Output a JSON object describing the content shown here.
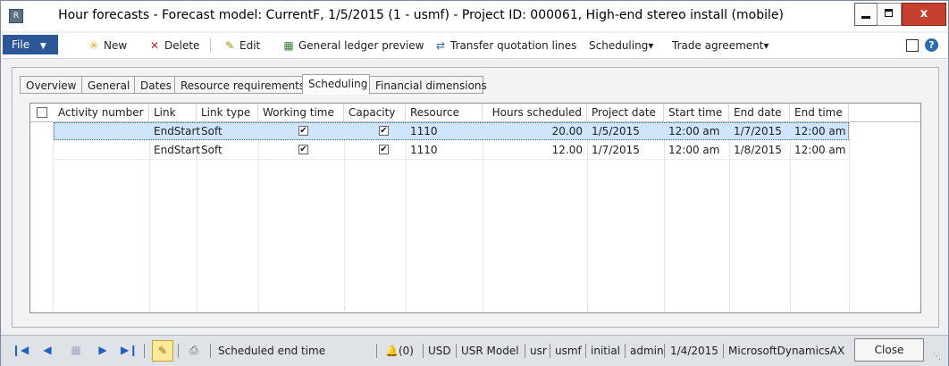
{
  "window": {
    "title": "Hour forecasts - Forecast model: CurrentF, 1/5/2015 (1 - usmf) - Project ID: 000061, High-end stereo install (mobile)",
    "close_glyph": "x",
    "app_icon_glyph": "R"
  },
  "ribbon": {
    "file": "File",
    "new": "New",
    "delete": "Delete",
    "edit": "Edit",
    "gl_preview": "General ledger preview",
    "transfer": "Transfer quotation lines",
    "scheduling": "Scheduling",
    "trade_agreement": "Trade agreement",
    "dropdown_glyph": "▾"
  },
  "tabs": [
    "Overview",
    "General",
    "Dates",
    "Resource requirements",
    "Scheduling",
    "Financial dimensions"
  ],
  "grid": {
    "columns": [
      "Activity number",
      "Link",
      "Link type",
      "Working time",
      "Capacity",
      "Resource",
      "Hours scheduled",
      "Project date",
      "Start time",
      "End date",
      "End time"
    ],
    "rows": [
      {
        "activity": "",
        "link": "EndStart",
        "link_type": "Soft",
        "working_time": "✔",
        "capacity": "✔",
        "resource": "1110",
        "hours": "20.00",
        "project_date": "1/5/2015",
        "start_time": "12:00 am",
        "end_date": "1/7/2015",
        "end_time": "12:00 am"
      },
      {
        "activity": "",
        "link": "EndStart",
        "link_type": "Soft",
        "working_time": "✔",
        "capacity": "✔",
        "resource": "1110",
        "hours": "12.00",
        "project_date": "1/7/2015",
        "start_time": "12:00 am",
        "end_date": "1/8/2015",
        "end_time": "12:00 am"
      }
    ]
  },
  "status": {
    "field_label": "Scheduled end time",
    "alerts": "(0)",
    "currency": "USD",
    "model": "USR Model",
    "user_layer": "usr",
    "company": "usmf",
    "partition": "initial",
    "user": "admin",
    "date": "1/4/2015",
    "server": "MicrosoftDynamicsAX",
    "close": "Close"
  }
}
